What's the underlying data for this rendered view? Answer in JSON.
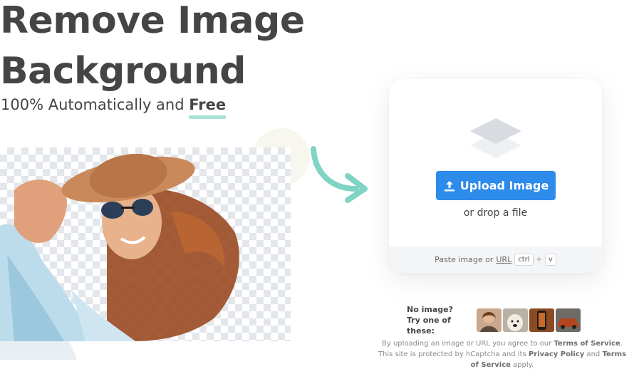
{
  "hero": {
    "title_line1": "Remove Image",
    "title_line2": "Background",
    "subtitle_prefix": "100% Automatically and ",
    "subtitle_emphasis": "Free"
  },
  "upload": {
    "button_label": "Upload Image",
    "drop_text": "or drop a file",
    "paste_prefix": "Paste image or ",
    "paste_url": "URL",
    "key_ctrl": "ctrl",
    "key_plus": "+",
    "key_v": "v"
  },
  "samples": {
    "label_line1": "No image?",
    "label_line2": "Try one of these:",
    "thumbnails": [
      "woman-portrait",
      "dog",
      "phone",
      "car"
    ]
  },
  "legal": {
    "line1_prefix": "By uploading an image or URL you agree to our ",
    "terms_link": "Terms of Service",
    "line1_suffix": ".",
    "line2_prefix": "This site is protected by hCaptcha and its ",
    "privacy_link": "Privacy Policy",
    "line2_and": " and ",
    "terms_link2": "Terms",
    "line3_terms": "of Service",
    "line3_suffix": " apply."
  },
  "colors": {
    "primary_button": "#2d8bea",
    "accent_underline": "#a8e0d5",
    "arrow": "#7fd4c4",
    "heading_text": "#454545"
  }
}
